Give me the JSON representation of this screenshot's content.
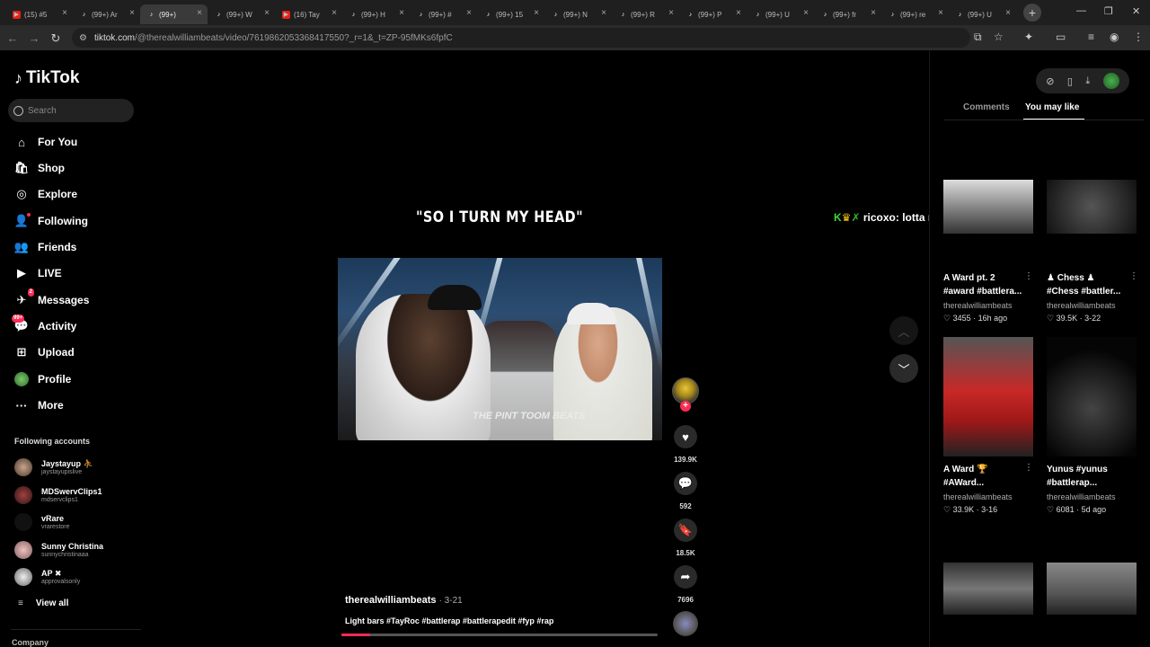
{
  "browser": {
    "tabs": [
      {
        "label": "(15) #5",
        "type": "yt",
        "active": false
      },
      {
        "label": "(99+) Ar",
        "type": "tk",
        "active": false
      },
      {
        "label": "(99+)",
        "type": "tk",
        "active": true
      },
      {
        "label": "(99+) W",
        "type": "tk",
        "active": false
      },
      {
        "label": "(16) Tay",
        "type": "yt",
        "active": false
      },
      {
        "label": "(99+) H",
        "type": "tk",
        "active": false
      },
      {
        "label": "(99+) #",
        "type": "tk",
        "active": false
      },
      {
        "label": "(99+) 15",
        "type": "tk",
        "active": false
      },
      {
        "label": "(99+) N",
        "type": "tk",
        "active": false
      },
      {
        "label": "(99+) R",
        "type": "tk",
        "active": false
      },
      {
        "label": "(99+) P",
        "type": "tk",
        "active": false
      },
      {
        "label": "(99+) U",
        "type": "tk",
        "active": false
      },
      {
        "label": "(99+) fr",
        "type": "tk",
        "active": false
      },
      {
        "label": "(99+) re",
        "type": "tk",
        "active": false
      },
      {
        "label": "(99+) U",
        "type": "tk",
        "active": false
      }
    ],
    "url_host": "tiktok.com",
    "url_path": "/@therealwilliambeats/video/7619862053368417550?_r=1&_t=ZP-95fMKs6fpfC"
  },
  "sidebar": {
    "logo": "TikTok",
    "search_placeholder": "Search",
    "nav": [
      {
        "label": "For You",
        "icon": "home-icon"
      },
      {
        "label": "Shop",
        "icon": "shop-icon"
      },
      {
        "label": "Explore",
        "icon": "compass-icon"
      },
      {
        "label": "Following",
        "icon": "following-icon"
      },
      {
        "label": "Friends",
        "icon": "friends-icon"
      },
      {
        "label": "LIVE",
        "icon": "live-icon"
      },
      {
        "label": "Messages",
        "icon": "messages-icon"
      },
      {
        "label": "Activity",
        "icon": "activity-icon"
      },
      {
        "label": "Upload",
        "icon": "upload-icon"
      },
      {
        "label": "Profile",
        "icon": "profile-icon"
      },
      {
        "label": "More",
        "icon": "more-icon"
      }
    ],
    "messages_badge": "2",
    "activity_badge": "99+",
    "following_title": "Following accounts",
    "accounts": [
      {
        "name": "Jaystayup ⛹",
        "handle": "jaystayupislive"
      },
      {
        "name": "MDSwervClips1",
        "handle": "mdservclips1"
      },
      {
        "name": "vRare",
        "handle": "vrarestore"
      },
      {
        "name": "Sunny Christina",
        "handle": "sunnychristinaaa"
      },
      {
        "name": "AP ✖",
        "handle": "approvalsonly"
      }
    ],
    "view_all": "View all",
    "company": "Company"
  },
  "player": {
    "caption_top": "\"SO I TURN MY HEAD\"",
    "watermark": "THE PINT TOOM BEATS",
    "overlay_chat_user": "ricoxo",
    "overlay_chat_text": "lotta niggas watch anything",
    "author": "therealwilliambeats",
    "date": "3-21",
    "description": "Light bars #TayRoc #battlerap #battlerapedit #fyp #rap",
    "progress": 0.09,
    "likes": "139.9K",
    "comments": "592",
    "saves": "18.5K",
    "shares": "7696"
  },
  "right_panel": {
    "tab_comments": "Comments",
    "tab_you_may_like": "You may like",
    "cards": [
      {
        "title_1": "A Ward pt. 2",
        "title_2": "#award #battlera...",
        "author": "therealwilliambeats",
        "likes": "3455",
        "age": "16h ago"
      },
      {
        "title_1": "♟ Chess ♟",
        "title_2": "#Chess #battler...",
        "author": "therealwilliambeats",
        "likes": "39.5K",
        "age": "3-22"
      },
      {
        "title_1": "A Ward 🏆",
        "title_2": "#AWard...",
        "author": "therealwilliambeats",
        "likes": "33.9K",
        "age": "3-16"
      },
      {
        "title_1": "Yunus #yunus",
        "title_2": "#battlerap...",
        "author": "therealwilliambeats",
        "likes": "6081",
        "age": "5d ago"
      }
    ]
  }
}
